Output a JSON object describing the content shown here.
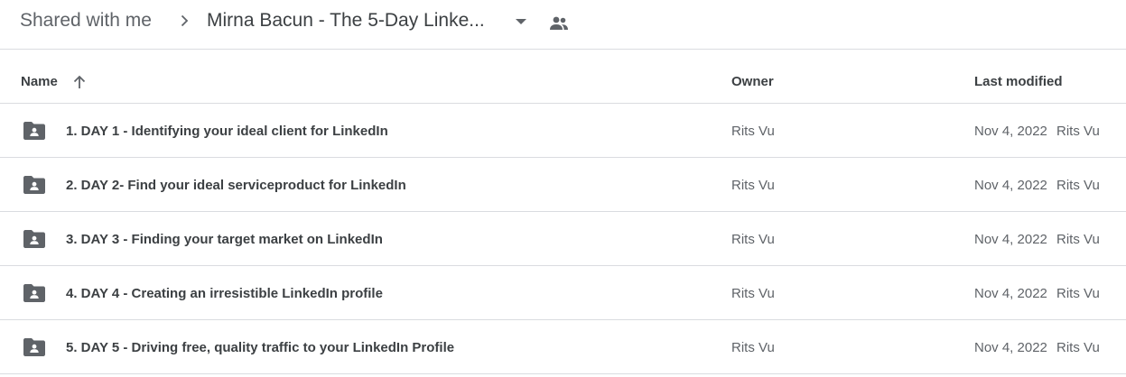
{
  "breadcrumb": {
    "root": "Shared with me",
    "current": "Mirna Bacun - The 5-Day Linke..."
  },
  "icons": {
    "separator": "chevron-right-icon",
    "dropdown": "arrow-drop-down-icon",
    "shared": "people-icon",
    "sort": "arrow-upward-icon",
    "folder": "shared-folder-icon"
  },
  "columns": {
    "name": "Name",
    "owner": "Owner",
    "last_modified": "Last modified"
  },
  "rows": [
    {
      "name": "1. DAY 1 - Identifying your ideal client for LinkedIn",
      "owner": "Rits Vu",
      "date": "Nov 4, 2022",
      "modifier": "Rits Vu"
    },
    {
      "name": "2. DAY 2- Find your ideal serviceproduct for LinkedIn",
      "owner": "Rits Vu",
      "date": "Nov 4, 2022",
      "modifier": "Rits Vu"
    },
    {
      "name": "3. DAY 3 - Finding your target market on LinkedIn",
      "owner": "Rits Vu",
      "date": "Nov 4, 2022",
      "modifier": "Rits Vu"
    },
    {
      "name": "4. DAY 4 - Creating an irresistible LinkedIn profile",
      "owner": "Rits Vu",
      "date": "Nov 4, 2022",
      "modifier": "Rits Vu"
    },
    {
      "name": "5. DAY 5 - Driving free, quality traffic to your LinkedIn Profile",
      "owner": "Rits Vu",
      "date": "Nov 4, 2022",
      "modifier": "Rits Vu"
    }
  ],
  "colors": {
    "text_primary": "#3c4043",
    "text_secondary": "#5f6368",
    "divider": "#dadce0",
    "icon": "#5f6368"
  }
}
